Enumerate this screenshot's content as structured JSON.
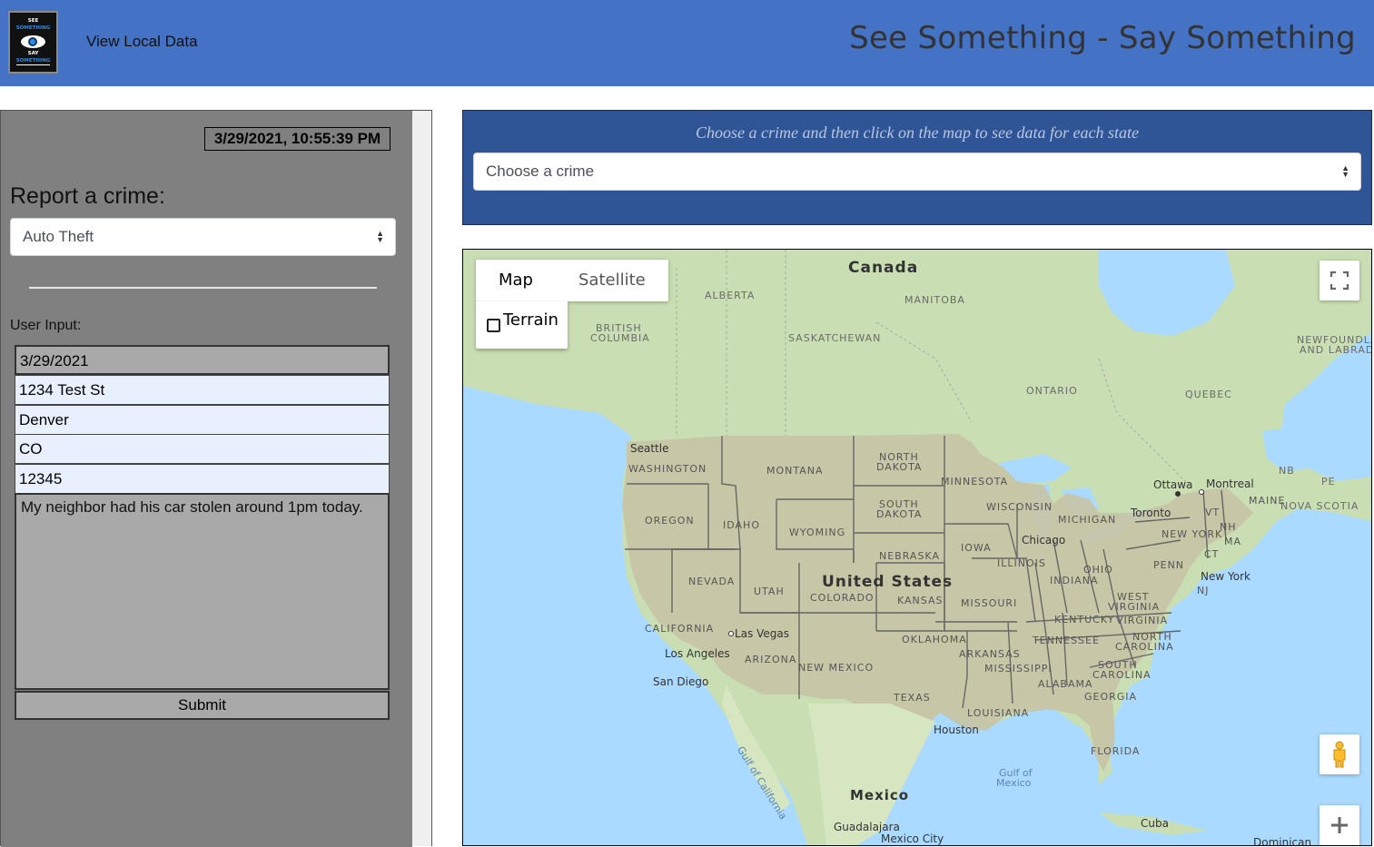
{
  "header": {
    "logo": {
      "line1": "SEE",
      "line2": "SOMETHING",
      "line3": "SAY",
      "line4": "SOMETHING"
    },
    "nav_link": "View Local Data",
    "site_title": "See Something - Say Something",
    "accent_color": "#4472c4"
  },
  "report_panel": {
    "datetime": "3/29/2021, 10:55:39 PM",
    "report_label": "Report a crime:",
    "crime_select_value": "Auto Theft",
    "user_input_label": "User Input:",
    "fields": {
      "date": "3/29/2021",
      "street": "1234 Test St",
      "city": "Denver",
      "state": "CO",
      "zip": "12345"
    },
    "description": "My neighbor had his car stolen around 1pm today.",
    "submit_label": "Submit",
    "panel_color": "#808080"
  },
  "crime_chooser": {
    "hint": "Choose a crime and then click on the map to see data for each state",
    "select_value": "Choose a crime",
    "background_color": "#2f5597"
  },
  "map": {
    "map_type_buttons": [
      "Map",
      "Satellite"
    ],
    "active_map_type": "Map",
    "terrain_label": "Terrain",
    "terrain_checked": false,
    "controls": [
      "fullscreen-icon",
      "pegman-icon",
      "zoom-in-icon"
    ],
    "labels": {
      "countries": {
        "canada": "Canada",
        "united_states": "United States",
        "mexico": "Mexico"
      },
      "regions": {
        "alberta": "ALBERTA",
        "manitoba": "MANITOBA",
        "british_columbia_1": "BRITISH",
        "british_columbia_2": "COLUMBIA",
        "saskatchewan": "SASKATCHEWAN",
        "ontario": "ONTARIO",
        "quebec": "QUEBEC",
        "newfoundland_1": "NEWFOUNDLA",
        "newfoundland_2": "AND LABRAD",
        "nb": "NB",
        "pe": "PE",
        "nova_scotia": "NOVA SCOTIA"
      },
      "states": {
        "washington": "WASHINGTON",
        "oregon": "OREGON",
        "california": "CALIFORNIA",
        "idaho": "IDAHO",
        "nevada": "NEVADA",
        "montana": "MONTANA",
        "wyoming": "WYOMING",
        "utah": "UTAH",
        "arizona": "ARIZONA",
        "colorado": "COLORADO",
        "new_mexico": "NEW MEXICO",
        "north_dakota_1": "NORTH",
        "north_dakota_2": "DAKOTA",
        "south_dakota_1": "SOUTH",
        "south_dakota_2": "DAKOTA",
        "nebraska": "NEBRASKA",
        "kansas": "KANSAS",
        "oklahoma": "OKLAHOMA",
        "texas": "TEXAS",
        "minnesota": "MINNESOTA",
        "iowa": "IOWA",
        "missouri": "MISSOURI",
        "arkansas": "ARKANSAS",
        "louisiana": "LOUISIANA",
        "wisconsin": "WISCONSIN",
        "illinois": "ILLINOIS",
        "mississippi": "MISSISSIPPI",
        "michigan": "MICHIGAN",
        "indiana": "INDIANA",
        "kentucky": "KENTUCKY",
        "tennessee": "TENNESSEE",
        "alabama": "ALABAMA",
        "ohio": "OHIO",
        "west_virginia_1": "WEST",
        "west_virginia_2": "VIRGINIA",
        "virginia": "VIRGINIA",
        "north_carolina_1": "NORTH",
        "north_carolina_2": "CAROLINA",
        "south_carolina_1": "SOUTH",
        "south_carolina_2": "CAROLINA",
        "georgia": "GEORGIA",
        "florida": "FLORIDA",
        "penn": "PENN",
        "new_york": "NEW YORK",
        "vt": "VT",
        "nh": "NH",
        "maine": "MAINE",
        "ma": "MA",
        "ct": "CT",
        "nj": "NJ"
      },
      "cities": {
        "seattle": "Seattle",
        "las_vegas": "Las Vegas",
        "los_angeles": "Los Angeles",
        "san_diego": "San Diego",
        "chicago": "Chicago",
        "toronto": "Toronto",
        "ottawa": "Ottawa",
        "montreal": "Montreal",
        "new_york_city": "New York",
        "houston": "Houston",
        "guadalajara": "Guadalajara",
        "mexico_city": "Mexico City",
        "cuba": "Cuba",
        "dominican": "Dominican"
      },
      "water": {
        "gulf_of_california": "Gulf of California",
        "gulf_of_mexico_1": "Gulf of",
        "gulf_of_mexico_2": "Mexico"
      }
    },
    "colors": {
      "water": "#aadaff",
      "land": "#c9dfb3",
      "states_highlight": "#c6c3a5",
      "state_border": "#666666"
    }
  }
}
